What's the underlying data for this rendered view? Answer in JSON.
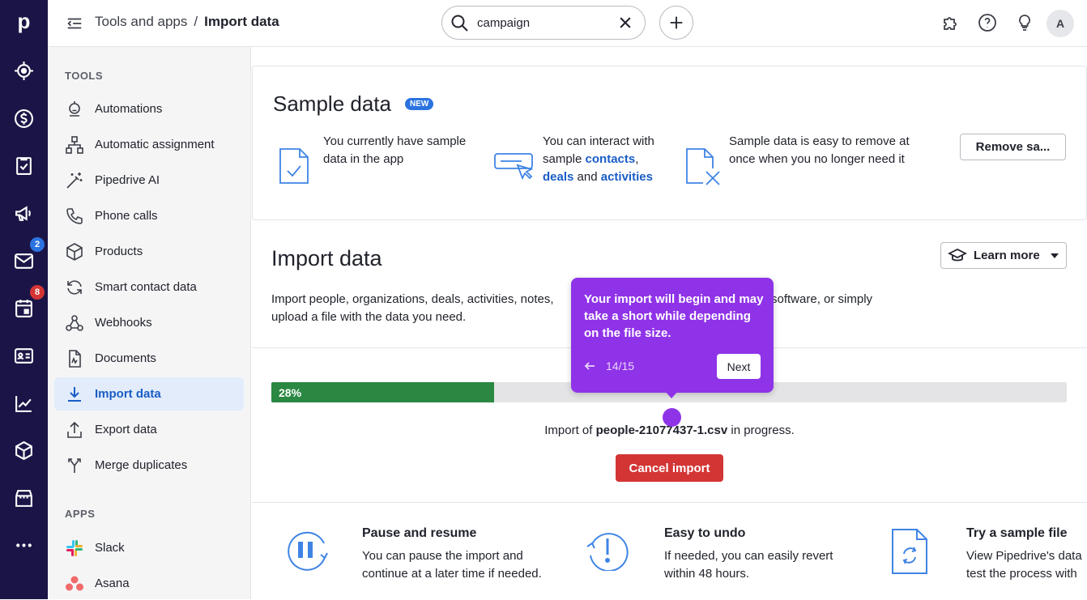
{
  "rail": {
    "logo": "p",
    "icons": [
      "target-icon",
      "dollar-icon",
      "clipboard-check-icon",
      "megaphone-icon",
      "mail-icon",
      "calendar-icon",
      "contact-card-icon",
      "chart-icon",
      "box-icon",
      "store-icon",
      "more-icon"
    ],
    "mail_badge": "2",
    "calendar_badge": "8"
  },
  "topbar": {
    "breadcrumb_parent": "Tools and apps",
    "breadcrumb_sep": "/",
    "breadcrumb_current": "Import data",
    "search_value": "campaign",
    "avatar_initial": "A"
  },
  "sidebar": {
    "tools_title": "TOOLS",
    "apps_title": "APPS",
    "items": [
      {
        "label": "Automations"
      },
      {
        "label": "Automatic assignment"
      },
      {
        "label": "Pipedrive AI"
      },
      {
        "label": "Phone calls"
      },
      {
        "label": "Products"
      },
      {
        "label": "Smart contact data"
      },
      {
        "label": "Webhooks"
      },
      {
        "label": "Documents"
      },
      {
        "label": "Import data"
      },
      {
        "label": "Export data"
      },
      {
        "label": "Merge duplicates"
      }
    ],
    "apps": [
      {
        "label": "Slack"
      },
      {
        "label": "Asana"
      }
    ]
  },
  "sample": {
    "title": "Sample data",
    "badge": "NEW",
    "feat1_line1": "You currently have sample",
    "feat1_line2": "data in the app",
    "feat2_line1": "You can interact with",
    "feat2_pre": "sample ",
    "feat2_contacts": "contacts",
    "feat2_comma": ",",
    "feat2_deals": "deals",
    "feat2_and": " and ",
    "feat2_activities": "activities",
    "feat3_line1": "Sample data is easy to remove at",
    "feat3_line2": "once when you no longer need it",
    "remove_button": "Remove sa..."
  },
  "import": {
    "title": "Import data",
    "learn_more": "Learn more",
    "desc_line1": "Import people, organizations, deals, activities, notes,",
    "desc_line1_tail": "software, or simply",
    "desc_line2": "upload a file with the data you need.",
    "progress_label": "28%",
    "progress_value": 0.28,
    "status_pre": "Import of ",
    "status_file": "people-21077437-1.csv",
    "status_post": " in progress.",
    "cancel": "Cancel import"
  },
  "info": {
    "pause_title": "Pause and resume",
    "pause_l1": "You can pause the import and",
    "pause_l2": "continue at a later time if needed.",
    "undo_title": "Easy to undo",
    "undo_l1": "If needed, you can easily revert",
    "undo_l2": "within 48 hours.",
    "sample_title": "Try a sample file",
    "sample_l1": "View Pipedrive's data",
    "sample_l2": "test the process with"
  },
  "tooltip": {
    "text": "Your import will begin and may take a short while depending on the file size.",
    "count": "14/15",
    "next": "Next"
  },
  "colors": {
    "rail": "#1b1547",
    "accent": "#1a5dc6",
    "progress": "#2a8842",
    "danger": "#d33535",
    "tooltip": "#8f33e8"
  }
}
